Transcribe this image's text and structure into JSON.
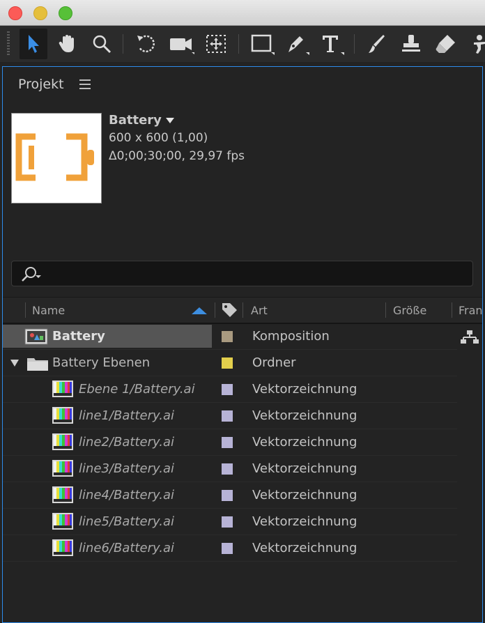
{
  "window": {
    "controls": [
      "close",
      "minimize",
      "zoom"
    ]
  },
  "toolbar": {
    "tools": [
      {
        "name": "selection-tool-icon",
        "active": true
      },
      {
        "name": "hand-tool-icon"
      },
      {
        "name": "zoom-tool-icon"
      },
      {
        "name": "rotation-tool-icon"
      },
      {
        "name": "camera-tool-icon"
      },
      {
        "name": "pan-behind-tool-icon"
      },
      {
        "name": "rectangle-tool-icon"
      },
      {
        "name": "pen-tool-icon"
      },
      {
        "name": "type-tool-icon"
      },
      {
        "name": "brush-tool-icon"
      },
      {
        "name": "clone-stamp-tool-icon"
      },
      {
        "name": "eraser-tool-icon"
      },
      {
        "name": "puppet-tool-icon"
      }
    ]
  },
  "panel": {
    "title": "Projekt",
    "selected": {
      "name": "Battery",
      "dimensions": "600 x 600 (1,00)",
      "duration": "Δ0;00;30;00, 29,97 fps",
      "accent": "#f0a13a"
    },
    "search": {
      "value": "",
      "placeholder": ""
    },
    "columns": {
      "name": "Name",
      "type": "Art",
      "size": "Größe",
      "frame": "Fran"
    },
    "items": [
      {
        "name": "Battery",
        "type": "Komposition",
        "label_color": "#a99a80",
        "icon": "composition-icon",
        "style": "bold"
      },
      {
        "name": "Battery Ebenen",
        "type": "Ordner",
        "label_color": "#e3cf4c",
        "icon": "folder-icon",
        "style": "normal"
      },
      {
        "name": "Ebene 1/Battery.ai",
        "type": "Vektorzeichnung",
        "label_color": "#b7b3d6",
        "icon": "footage-icon",
        "style": "italic"
      },
      {
        "name": "line1/Battery.ai",
        "type": "Vektorzeichnung",
        "label_color": "#b7b3d6",
        "icon": "footage-icon",
        "style": "italic"
      },
      {
        "name": "line2/Battery.ai",
        "type": "Vektorzeichnung",
        "label_color": "#b7b3d6",
        "icon": "footage-icon",
        "style": "italic"
      },
      {
        "name": "line3/Battery.ai",
        "type": "Vektorzeichnung",
        "label_color": "#b7b3d6",
        "icon": "footage-icon",
        "style": "italic"
      },
      {
        "name": "line4/Battery.ai",
        "type": "Vektorzeichnung",
        "label_color": "#b7b3d6",
        "icon": "footage-icon",
        "style": "italic"
      },
      {
        "name": "line5/Battery.ai",
        "type": "Vektorzeichnung",
        "label_color": "#b7b3d6",
        "icon": "footage-icon",
        "style": "italic"
      },
      {
        "name": "line6/Battery.ai",
        "type": "Vektorzeichnung",
        "label_color": "#b7b3d6",
        "icon": "footage-icon",
        "style": "italic"
      }
    ]
  }
}
